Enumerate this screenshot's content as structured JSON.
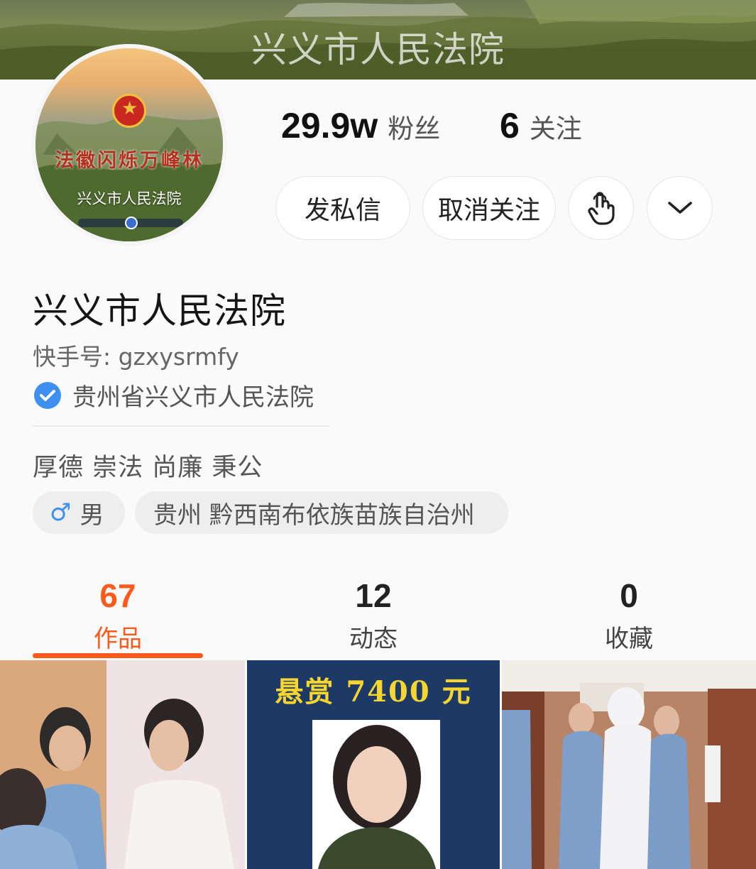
{
  "banner": {
    "title": "兴义市人民法院"
  },
  "avatar": {
    "slogan": "法徽闪烁万峰林",
    "court_name": "兴义市人民法院"
  },
  "stats": {
    "followers_count": "29.9w",
    "followers_label": "粉丝",
    "following_count": "6",
    "following_label": "关注"
  },
  "actions": {
    "message_label": "发私信",
    "unfollow_label": "取消关注",
    "touch_icon": "hand-pointer-icon",
    "more_icon": "chevron-down-icon"
  },
  "profile": {
    "name": "兴义市人民法院",
    "kuaishou_id": "快手号: gzxysrmfy",
    "verified_text": "贵州省兴义市人民法院",
    "bio": "厚德 崇法 尚廉 秉公",
    "gender": "男",
    "location": "贵州 黔西南布依族苗族自治州"
  },
  "tabs": [
    {
      "count": "67",
      "label": "作品",
      "active": true
    },
    {
      "count": "12",
      "label": "动态",
      "active": false
    },
    {
      "count": "0",
      "label": "收藏",
      "active": false
    }
  ],
  "videos": [
    {
      "caption": ""
    },
    {
      "caption": "悬赏 7400 元"
    },
    {
      "caption": ""
    }
  ],
  "colors": {
    "accent": "#fe5a1d",
    "verify": "#3d8ff0",
    "poster_bg": "#1d3a67",
    "poster_text": "#f7d52f"
  }
}
